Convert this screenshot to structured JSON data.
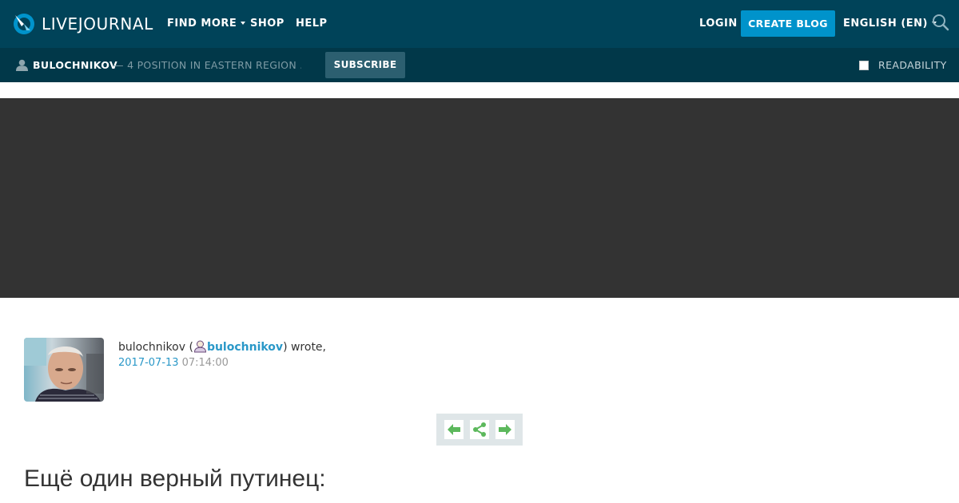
{
  "header": {
    "logo_text": "LIVEJOURNAL",
    "nav": {
      "find_more": "FIND MORE",
      "shop": "SHOP",
      "help": "HELP"
    },
    "login": "LOGIN",
    "create_blog": "CREATE BLOG",
    "language": "ENGLISH (EN)",
    "colors": {
      "background": "#004359",
      "accent": "#0093cb"
    },
    "icons": {
      "logo": "livejournal-logo-icon",
      "search": "search-icon"
    }
  },
  "journal_bar": {
    "username": "BULOCHNIKOV",
    "description": "— 4 POSITION IN EASTERN REGION ...",
    "subscribe": "SUBSCRIBE",
    "readability": "READABILITY",
    "readability_checked": false,
    "colors": {
      "background": "#013849"
    }
  },
  "entry": {
    "author_name": "bulochnikov",
    "author_user": "bulochnikov",
    "open_paren": " (",
    "wrote": ") wrote,",
    "date": "2017-07-13",
    "time": "07:14:00",
    "title": "Ещё один верный путинец:",
    "controls": [
      "prev-entry-icon",
      "share-icon",
      "next-entry-icon"
    ]
  }
}
